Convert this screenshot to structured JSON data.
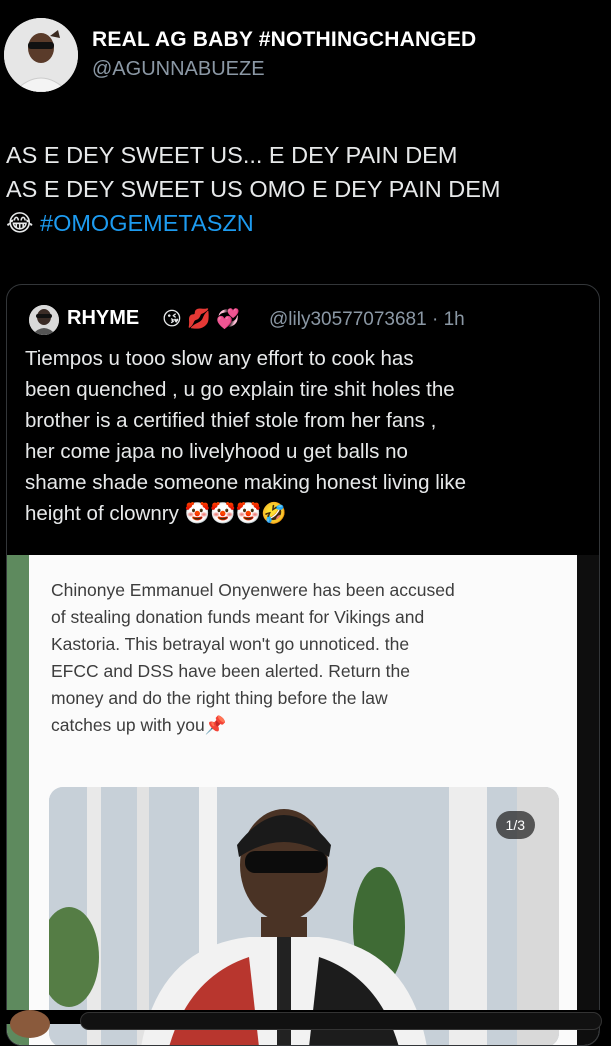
{
  "post": {
    "name": "REAL AG BABY #NOTHINGCHANGED",
    "handle": "@AGUNNABUEZE",
    "lines": [
      "AS E DEY SWEET US... E DEY PAIN DEM",
      "AS E DEY SWEET US OMO E DEY PAIN DEM"
    ],
    "emoji_line": "😂",
    "hashtag": "#OMOGEMETASZN"
  },
  "quote": {
    "name": "RHYME",
    "emojis": "😘 💋 💞",
    "handle_time": "@lily30577073681 · 1h",
    "lines": [
      "Tiempos u tooo slow any effort to cook has",
      "been quenched , u go explain tire shit holes the",
      "brother is a certified thief stole from her fans ,",
      "her come japa no livelyhood u get balls no",
      "shame shade someone making honest living like",
      "height of clownry 🤡🤡🤡🤣"
    ],
    "media": {
      "lines": [
        "Chinonye Emmanuel Onyenwere has been accused",
        "of stealing donation funds meant for Vikings and",
        "Kastoria. This betrayal won't go unnoticed. the",
        "EFCC and DSS have been alerted. Return the",
        "money and do the right thing before the law",
        "catches up with you📌"
      ],
      "counter": "1/3"
    }
  },
  "colors": {
    "background": "#000000",
    "text": "#e7e9ea",
    "muted": "#8b98a5",
    "link": "#1d9bf0"
  }
}
